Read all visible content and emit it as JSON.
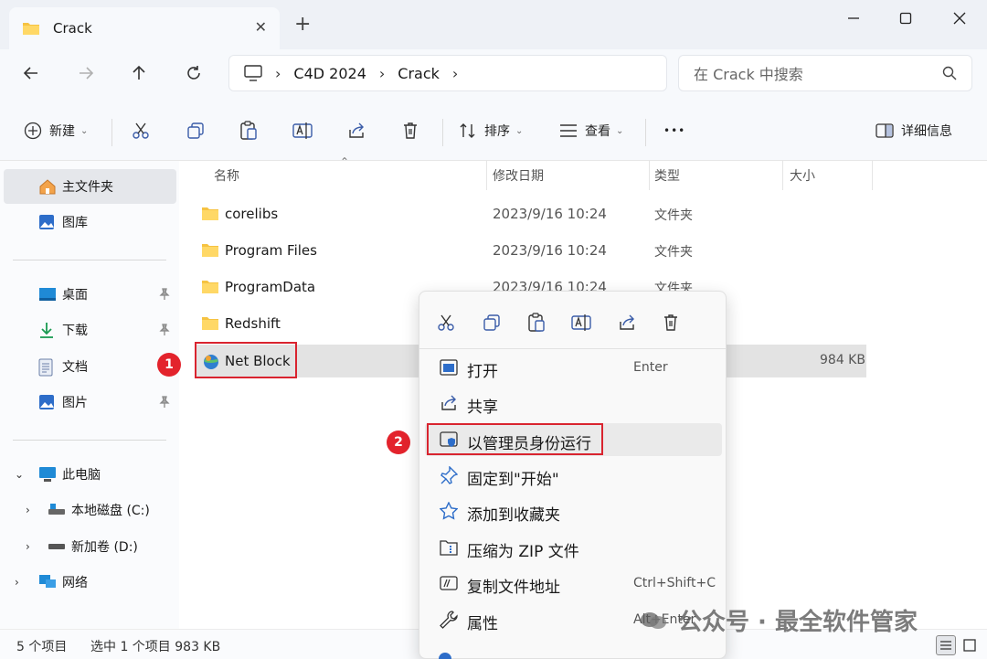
{
  "window": {
    "tab_title": "Crack",
    "new_tab": "+"
  },
  "nav": {
    "breadcrumb": [
      "C4D 2024",
      "Crack"
    ],
    "search_placeholder": "在 Crack 中搜索"
  },
  "toolbar": {
    "new_label": "新建",
    "sort_label": "排序",
    "view_label": "查看",
    "more_label": "•••",
    "details_label": "详细信息"
  },
  "sidebar": {
    "home": "主文件夹",
    "gallery": "图库",
    "desktop": "桌面",
    "downloads": "下载",
    "documents": "文档",
    "pictures": "图片",
    "this_pc": "此电脑",
    "drive_c": "本地磁盘 (C:)",
    "drive_d": "新加卷 (D:)",
    "network": "网络"
  },
  "columns": {
    "name": "名称",
    "modified": "修改日期",
    "type": "类型",
    "size": "大小"
  },
  "files": [
    {
      "name": "corelibs",
      "date": "2023/9/16 10:24",
      "type": "文件夹",
      "size": ""
    },
    {
      "name": "Program Files",
      "date": "2023/9/16 10:24",
      "type": "文件夹",
      "size": ""
    },
    {
      "name": "ProgramData",
      "date": "2023/9/16 10:24",
      "type": "文件夹",
      "size": ""
    },
    {
      "name": "Redshift",
      "date": "",
      "type": "",
      "size": ""
    },
    {
      "name": "Net Block",
      "date": "",
      "type": "",
      "size": "984 KB"
    }
  ],
  "annotations": {
    "step1": "1",
    "step2": "2"
  },
  "context_menu": {
    "items": [
      {
        "label": "打开",
        "shortcut": "Enter"
      },
      {
        "label": "共享",
        "shortcut": ""
      },
      {
        "label": "以管理员身份运行",
        "shortcut": ""
      },
      {
        "label": "固定到\"开始\"",
        "shortcut": ""
      },
      {
        "label": "添加到收藏夹",
        "shortcut": ""
      },
      {
        "label": "压缩为 ZIP 文件",
        "shortcut": ""
      },
      {
        "label": "复制文件地址",
        "shortcut": "Ctrl+Shift+C"
      },
      {
        "label": "属性",
        "shortcut": "Alt+Enter"
      }
    ]
  },
  "status": {
    "item_count": "5 个项目",
    "selection": "选中 1 个项目  983 KB"
  },
  "watermark": "公众号 · 最全软件管家",
  "colors": {
    "accent": "#0067c0",
    "annotation_red": "#d9242f",
    "folder_yellow": "#f6c342"
  }
}
